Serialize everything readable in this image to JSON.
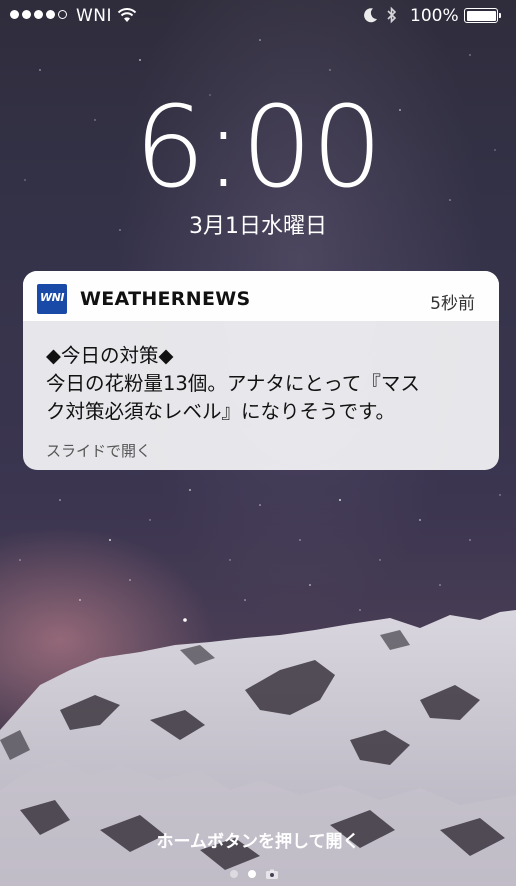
{
  "status_bar": {
    "carrier": "WNI",
    "battery": "100%"
  },
  "lock_screen": {
    "time": "6:00",
    "date": "3月1日水曜日"
  },
  "notification": {
    "icon_text": "WNI",
    "app_name": "WEATHERNEWS",
    "time_ago": "5秒前",
    "title": "◆今日の対策◆",
    "body_line1": "今日の花粉量13個。アナタにとって『マス",
    "body_line2": "ク対策必須なレベル』になりそうです。",
    "action": "スライドで開く"
  },
  "footer": {
    "home_hint": "ホームボタンを押して開く"
  },
  "colors": {
    "app_icon_bg": "#1a4aa8"
  }
}
